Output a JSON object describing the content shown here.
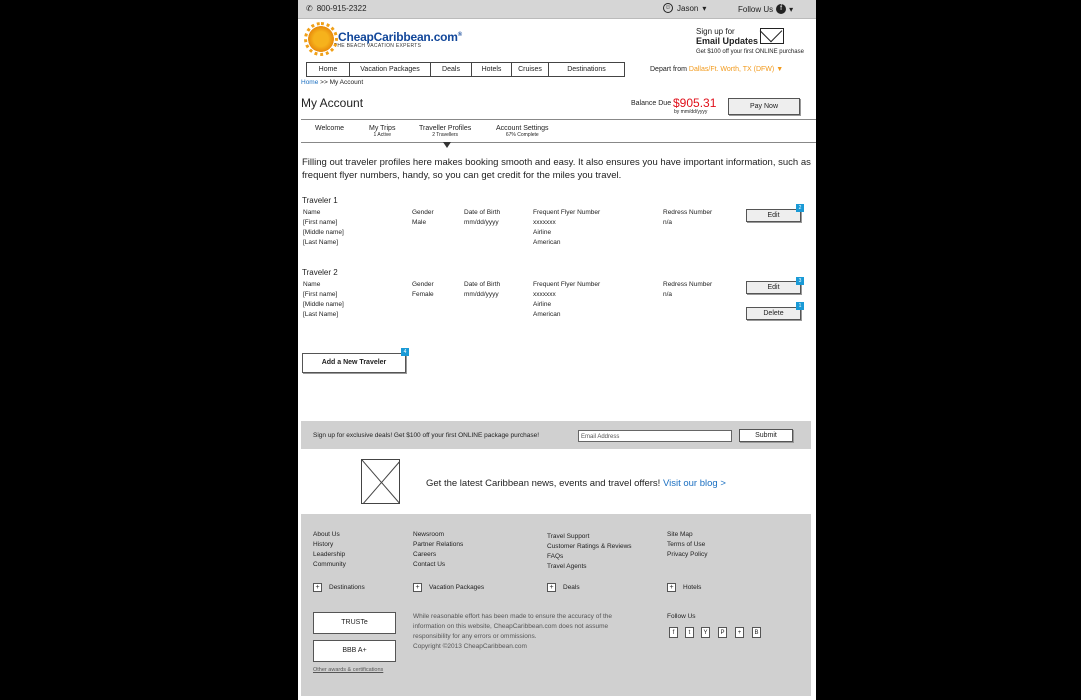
{
  "topbar": {
    "phone": "800-915-2322",
    "user": "Jason",
    "follow": "Follow Us"
  },
  "brand": {
    "name": "CheapCaribbean.com",
    "reg": "®",
    "tagline": "THE BEACH VACATION EXPERTS"
  },
  "signup": {
    "line1": "Sign up for",
    "line2": "Email Updates",
    "line3": "Get $100 off your first ONLINE purchase"
  },
  "nav": {
    "items": [
      "Home",
      "Vacation Packages",
      "Deals",
      "Hotels",
      "Cruises",
      "Destinations"
    ]
  },
  "depart": {
    "label": "Depart from",
    "value": "Dallas/Ft. Worth, TX (DFW)"
  },
  "breadcrumb": {
    "home": "Home",
    "sep": ">>",
    "current": "My Account"
  },
  "account": {
    "title": "My Account",
    "balance_label": "Balance Due",
    "balance": "$905.31",
    "by": "by mm/dd/yyyy",
    "pay": "Pay Now"
  },
  "tabs": [
    {
      "label": "Welcome",
      "sub": ""
    },
    {
      "label": "My Trips",
      "sub": "1 Active"
    },
    {
      "label": "Traveller Profiles",
      "sub": "2 Travellers"
    },
    {
      "label": "Account Settings",
      "sub": "67% Complete"
    }
  ],
  "intro": "Filling out traveler profiles here makes booking smooth and easy. It also ensures you have important information, such as frequent flyer numbers, handy, so you can get credit for the miles you travel.",
  "headers": {
    "name": "Name",
    "gender": "Gender",
    "dob": "Date of Birth",
    "ffn": "Frequent Flyer Number",
    "redress": "Redress Number"
  },
  "travelers": [
    {
      "title": "Traveler 1",
      "first": "[First name]",
      "middle": "[Middle name]",
      "last": "[Last Name]",
      "gender": "Male",
      "dob": "mm/dd/yyyy",
      "ff": "xxxxxxx",
      "airline_label": "Airline",
      "airline": "American",
      "redress": "n/a",
      "edit": "Edit",
      "edit_badge": "2"
    },
    {
      "title": "Traveler 2",
      "first": "[First name]",
      "middle": "[Middle name]",
      "last": "[Last Name]",
      "gender": "Female",
      "dob": "mm/dd/yyyy",
      "ff": "xxxxxxx",
      "airline_label": "Airline",
      "airline": "American",
      "redress": "n/a",
      "edit": "Edit",
      "edit_badge": "3",
      "delete": "Delete",
      "delete_badge": "1"
    }
  ],
  "add_traveler": {
    "label": "Add a New Traveler",
    "badge": "4"
  },
  "newsletter": {
    "text": "Sign up for exclusive deals! Get $100 off your first ONLINE package purchase!",
    "placeholder": "Email Address",
    "submit": "Submit"
  },
  "blog": {
    "text": "Get the latest Caribbean news, events and travel offers!",
    "link": "Visit our blog >"
  },
  "footer": {
    "col1": [
      "About Us",
      "History",
      "Leadership",
      "Community"
    ],
    "col2": [
      "Newsroom",
      "Partner Relations",
      "Careers",
      "Contact Us"
    ],
    "col3": [
      "Travel Support",
      "Customer Ratings & Reviews",
      "FAQs",
      "Travel Agents"
    ],
    "col4": [
      "Site Map",
      "Terms of Use",
      "Privacy Policy"
    ],
    "expanders": [
      "Destinations",
      "Vacation Packages",
      "Deals",
      "Hotels"
    ],
    "truste": "TRUSTe",
    "bbb": "BBB A+",
    "awards": "Other awards & certifications",
    "disclaimer": "While reasonable effort has been made to ensure the accuracy of the information on this website, CheapCaribbean.com does not assume responsibility for any errors or ommissions.",
    "copyright": "Copyright ©2013 CheapCaribbean.com",
    "follow": "Follow Us",
    "social": [
      "f",
      "t",
      "Y",
      "P",
      "+",
      "B"
    ]
  },
  "colors": {
    "brand_blue": "#12479a",
    "link": "#1a6fc1",
    "balance_red": "#e0101b",
    "badge_blue": "#1a9ad6",
    "depart_orange": "#f29a1c"
  }
}
